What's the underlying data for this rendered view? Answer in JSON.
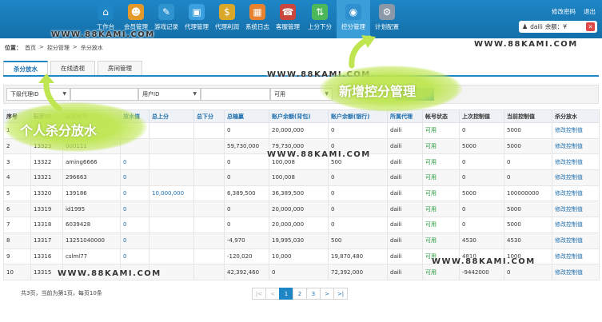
{
  "nav": [
    {
      "label": "工作台",
      "icon": "home-icon",
      "color": "#1f86c6",
      "glyph": "⌂"
    },
    {
      "label": "会员管理",
      "icon": "users-icon",
      "color": "#e49a2a",
      "glyph": "☻"
    },
    {
      "label": "游戏记录",
      "icon": "edit-icon",
      "color": "#2e94d0",
      "glyph": "✎"
    },
    {
      "label": "代理管理",
      "icon": "monitor-icon",
      "color": "#3aa0e0",
      "glyph": "▣"
    },
    {
      "label": "代理利润",
      "icon": "money-bag-icon",
      "color": "#d9a72a",
      "glyph": "$"
    },
    {
      "label": "系统日志",
      "icon": "calendar-icon",
      "color": "#e8822e",
      "glyph": "▦"
    },
    {
      "label": "客服管理",
      "icon": "support-icon",
      "color": "#c9473c",
      "glyph": "☎"
    },
    {
      "label": "上分下分",
      "icon": "updown-icon",
      "color": "#4db85a",
      "glyph": "⇅"
    },
    {
      "label": "控分管理",
      "icon": "gamepad-icon",
      "color": "#2f8fcf",
      "glyph": "◉"
    },
    {
      "label": "计划配置",
      "icon": "gears-icon",
      "color": "#8a98a8",
      "glyph": "⚙"
    }
  ],
  "top_links": {
    "change_password": "修改密码",
    "logout": "退出"
  },
  "user": {
    "name": "daili",
    "balance_label": "余额：¥"
  },
  "breadcrumb": {
    "label": "位置：",
    "items": [
      "首页",
      "控分管理",
      "杀分放水"
    ],
    "sep": ">"
  },
  "tabs": [
    "杀分放水",
    "在线透视",
    "房间管理"
  ],
  "filters": {
    "agent_select": "下级代理ID",
    "user_select": "用户ID",
    "status_select": "可用",
    "search_button": "搜索"
  },
  "table": {
    "headers": [
      "序号",
      "玩家ID",
      "玩家帐号",
      "放水值",
      "总上分",
      "总下分",
      "总输赢",
      "账户余额(背包)",
      "账户余额(银行)",
      "所属代理",
      "帐号状态",
      "上次控制值",
      "当前控制值",
      "杀分放水"
    ],
    "rows": [
      [
        "1",
        "",
        "",
        "",
        "",
        "",
        "0",
        "20,000,000",
        "0",
        "daili",
        "可用",
        "0",
        "5000",
        "修改控制值"
      ],
      [
        "2",
        "13323",
        "000111",
        "",
        "",
        "",
        "59,730,000",
        "79,730,000",
        "0",
        "daili",
        "可用",
        "5000",
        "5000",
        "修改控制值"
      ],
      [
        "3",
        "13322",
        "aming6666",
        "0",
        "",
        "",
        "0",
        "100,008",
        "500",
        "daili",
        "可用",
        "0",
        "0",
        "修改控制值"
      ],
      [
        "4",
        "13321",
        "296663",
        "0",
        "",
        "",
        "0",
        "100,008",
        "0",
        "daili",
        "可用",
        "0",
        "0",
        "修改控制值"
      ],
      [
        "5",
        "13320",
        "139186",
        "0",
        "10,000,000",
        "",
        "6,389,500",
        "36,389,500",
        "0",
        "daili",
        "可用",
        "5000",
        "100000000",
        "修改控制值"
      ],
      [
        "6",
        "13319",
        "id1995",
        "0",
        "",
        "",
        "0",
        "20,000,000",
        "0",
        "daili",
        "可用",
        "0",
        "5000",
        "修改控制值"
      ],
      [
        "7",
        "13318",
        "6039428",
        "0",
        "",
        "",
        "0",
        "20,000,000",
        "0",
        "daili",
        "可用",
        "0",
        "5000",
        "修改控制值"
      ],
      [
        "8",
        "13317",
        "13251040000",
        "0",
        "",
        "",
        "-4,970",
        "19,995,030",
        "500",
        "daili",
        "可用",
        "4530",
        "4530",
        "修改控制值"
      ],
      [
        "9",
        "13316",
        "cslml77",
        "0",
        "",
        "",
        "-120,020",
        "10,000",
        "19,870,480",
        "daili",
        "可用",
        "4810",
        "1000",
        "修改控制值"
      ],
      [
        "10",
        "13315",
        "",
        "",
        "",
        "",
        "42,392,460",
        "0",
        "72,392,000",
        "daili",
        "可用",
        "-9442000",
        "0",
        "修改控制值"
      ]
    ]
  },
  "pagination": {
    "info": "共3页，当前为第1页，每页10条",
    "buttons": [
      "|<",
      "<",
      "1",
      "2",
      "3",
      ">",
      ">|"
    ],
    "current": "1"
  },
  "overlays": {
    "watermark": "WWW.88KAMI.COM",
    "callout_new": "新增控分管理",
    "callout_personal": "个人杀分放水"
  },
  "colors": {
    "primary": "#1f86c6",
    "accent_green": "#bfe650",
    "status_green": "#2a9d3f",
    "link": "#1f6fae"
  }
}
